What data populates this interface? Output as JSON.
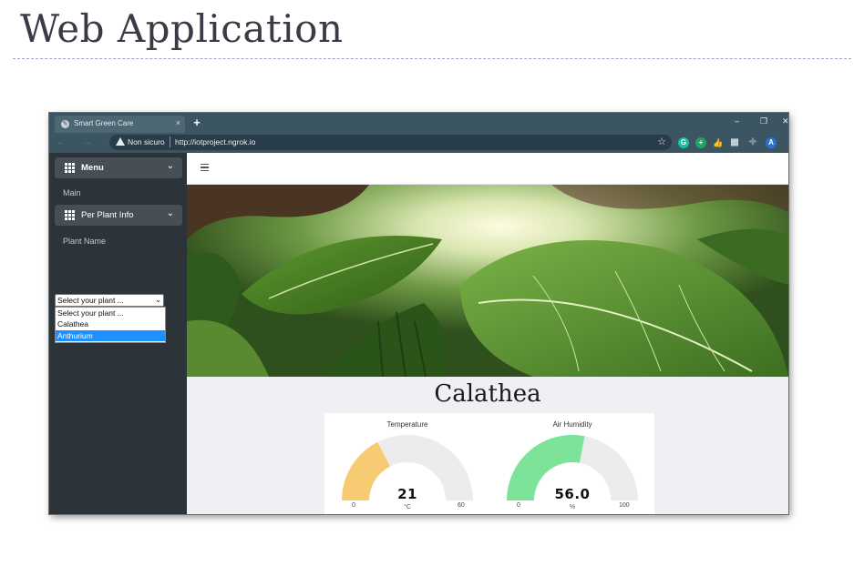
{
  "slide": {
    "title": "Web Application"
  },
  "browser": {
    "tab_title": "Smart Green Care",
    "tab_close": "×",
    "new_tab": "+",
    "window_controls": {
      "minimize": "–",
      "restore": "❐",
      "close": "✕"
    },
    "nav": "← → ⟳",
    "security_label": "Non sicuro",
    "url": "http://iotproject.ngrok.io",
    "star": "☆",
    "profile_initial": "A",
    "extension_letters": [
      "G",
      "+",
      "👍",
      "▦"
    ]
  },
  "sidebar": {
    "menu_label": "Menu",
    "menu_sub": "Main",
    "plant_info_label": "Per Plant Info",
    "plant_name_label": "Plant Name",
    "select": {
      "value": "Select your plant ...",
      "options": [
        "Select your plant ...",
        "Calathea",
        "Anthurium"
      ],
      "highlighted_index": 2
    }
  },
  "main": {
    "plant_name": "Calathea",
    "gauges": [
      {
        "title": "Temperature",
        "value": "21",
        "unit": "°C",
        "min": "0",
        "max": "60",
        "fraction": 0.35,
        "color": "#f7cb72"
      },
      {
        "title": "Air Humidity",
        "value": "56.0",
        "unit": "%",
        "min": "0",
        "max": "100",
        "fraction": 0.56,
        "color": "#7ce399"
      }
    ]
  },
  "colors": {
    "chrome": "#3c5563",
    "sidebar": "#2d3439",
    "accent": "#1e90ff"
  }
}
